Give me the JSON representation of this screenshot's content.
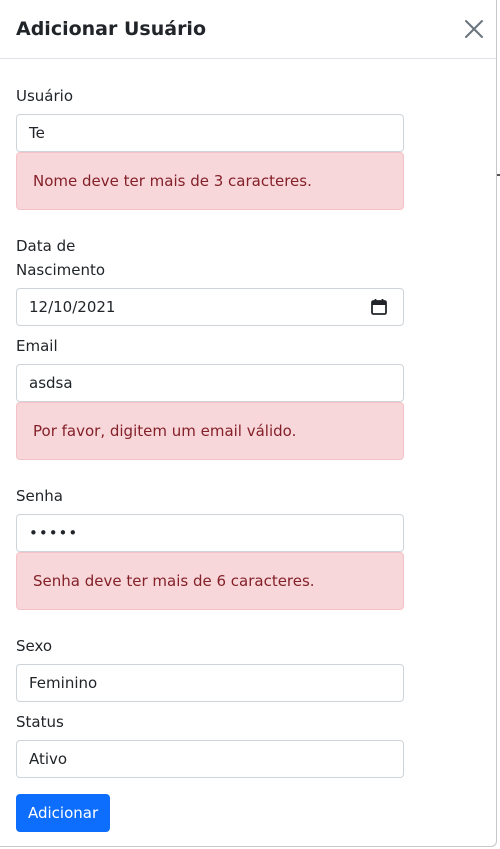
{
  "modal": {
    "title": "Adicionar Usuário",
    "close_icon": "close-icon"
  },
  "form": {
    "usuario": {
      "label": "Usuário",
      "value": "Te",
      "error": "Nome deve ter mais de 3 caracteres."
    },
    "nascimento": {
      "label_line1": "Data de",
      "label_line2": "Nascimento",
      "value": "12/10/2021",
      "icon": "calendar-icon"
    },
    "email": {
      "label": "Email",
      "value": "asdsa",
      "error": "Por favor, digitem um email válido."
    },
    "senha": {
      "label": "Senha",
      "value": "•••••",
      "error": "Senha deve ter mais de 6 caracteres."
    },
    "sexo": {
      "label": "Sexo",
      "value": "Feminino"
    },
    "status": {
      "label": "Status",
      "value": "Ativo"
    },
    "submit_label": "Adicionar"
  },
  "colors": {
    "primary": "#0d6efd",
    "danger_bg": "#f8d7da",
    "danger_text": "#842029",
    "danger_border": "#f5c2c7"
  }
}
